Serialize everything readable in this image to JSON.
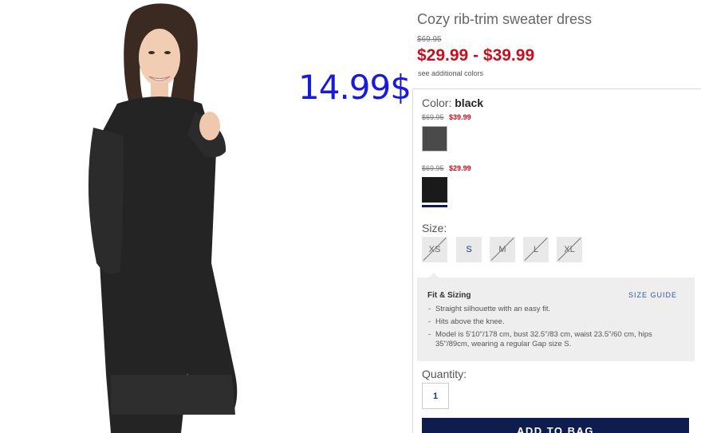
{
  "product": {
    "title": "Cozy rib-trim sweater dress",
    "original_price": "$69.95",
    "sale_range": "$29.99 - $39.99",
    "see_colors_link": "see additional colors"
  },
  "annotation": {
    "handwritten_price": "14.99$",
    "color": "#1a1adc"
  },
  "color_selector": {
    "label": "Color:",
    "selected": "black",
    "swatches": [
      {
        "name": "gray",
        "was": "$69.95",
        "now": "$39.99",
        "hex": "#4a4a4a"
      },
      {
        "name": "black",
        "was": "$69.95",
        "now": "$29.99",
        "hex": "#1a1a1a",
        "selected": true
      }
    ]
  },
  "size_selector": {
    "label": "Size:",
    "sizes": [
      {
        "label": "XS",
        "available": false
      },
      {
        "label": "S",
        "available": true
      },
      {
        "label": "M",
        "available": false
      },
      {
        "label": "L",
        "available": false
      },
      {
        "label": "XL",
        "available": false
      }
    ]
  },
  "fit_sizing": {
    "title": "Fit & Sizing",
    "size_guide_link": "SIZE GUIDE",
    "bullets": [
      "Straight silhouette with an easy fit.",
      "Hits above the knee.",
      "Model is 5'10\"/178 cm, bust 32.5\"/83 cm, waist 23.5\"/60 cm, hips 35\"/89cm, wearing a regular Gap size S."
    ]
  },
  "quantity": {
    "label": "Quantity:",
    "value": "1"
  },
  "add_to_bag": {
    "label": "ADD TO BAG"
  },
  "colors": {
    "sale_red": "#c50f1f",
    "navy": "#0f1d4e",
    "link_blue": "#2a5a9c"
  }
}
